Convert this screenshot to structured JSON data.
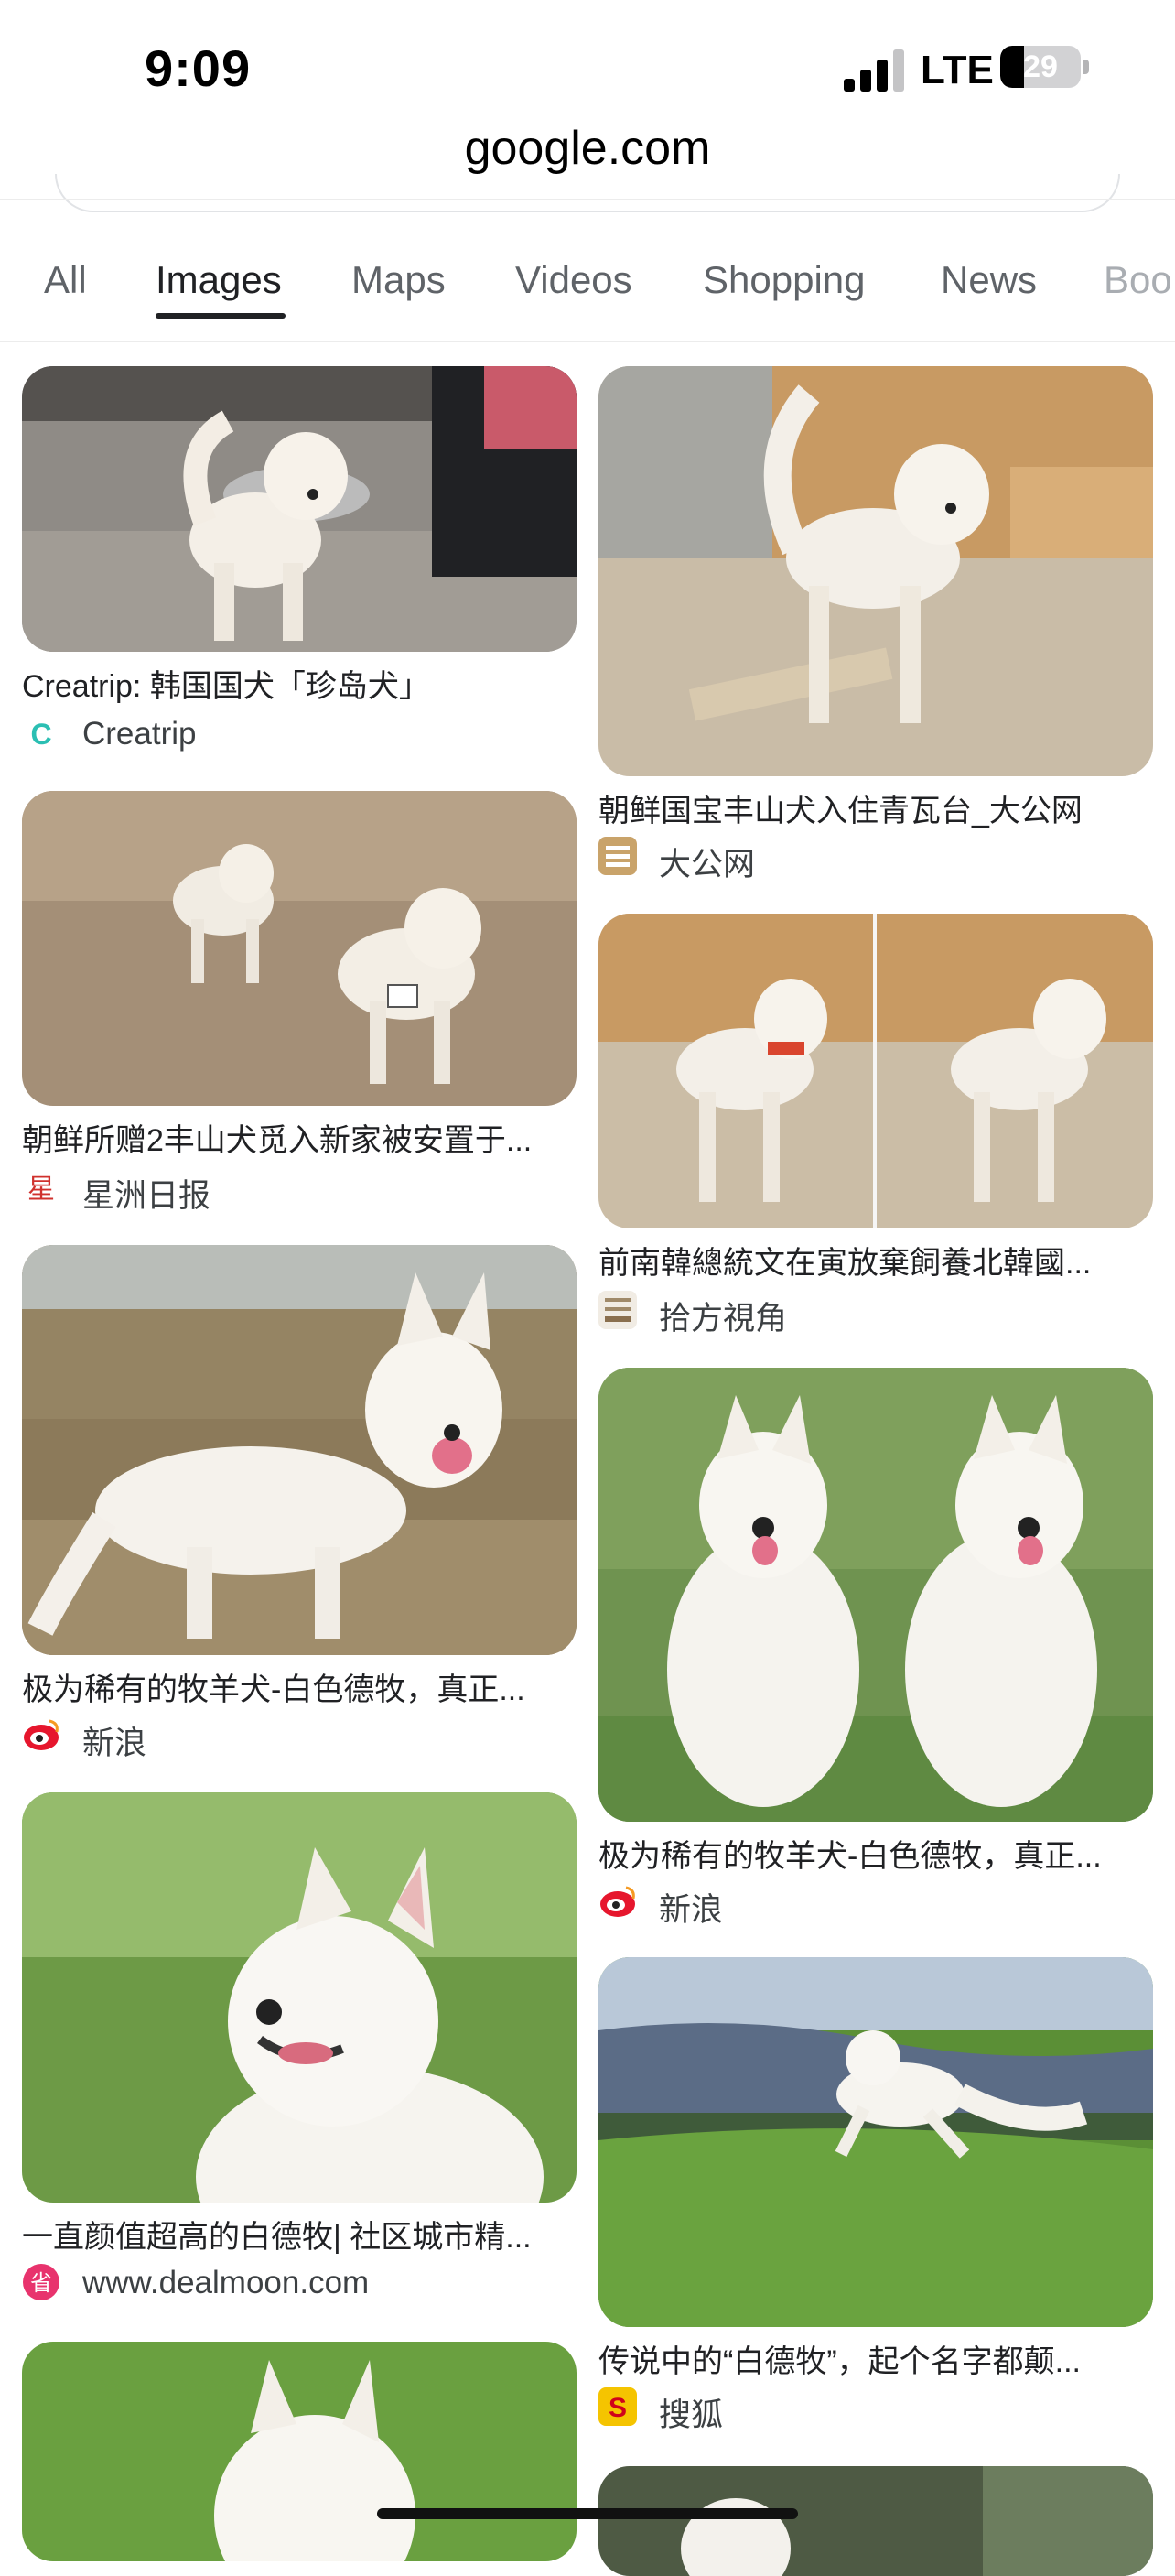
{
  "status_bar": {
    "time": "9:09",
    "network": "LTE",
    "battery_level": "29",
    "battery_fraction": 0.29
  },
  "browser": {
    "url": "google.com"
  },
  "tabs": [
    {
      "label": "All",
      "active": false
    },
    {
      "label": "Images",
      "active": true
    },
    {
      "label": "Maps",
      "active": false
    },
    {
      "label": "Videos",
      "active": false
    },
    {
      "label": "Shopping",
      "active": false
    },
    {
      "label": "News",
      "active": false
    },
    {
      "label": "Boo",
      "active": false
    }
  ],
  "results": [
    {
      "title": "Creatrip: 韩国国犬「珍岛犬」",
      "source": "Creatrip",
      "favicon": "creatrip-icon",
      "favicon_color": "#2bbfb3"
    },
    {
      "title": "朝鲜国宝丰山犬入住青瓦台_大公网",
      "source": "大公网",
      "favicon": "takungpao-icon",
      "favicon_color": "#c9a36a"
    },
    {
      "title": "朝鲜所赠2丰山犬觅入新家被安置于...",
      "source": "星洲日报",
      "favicon": "sinchew-icon",
      "favicon_color": "#d0312d"
    },
    {
      "title": "前南韓總統文在寅放棄飼養北韓國...",
      "source": "拾方視角",
      "favicon": "shifang-icon",
      "favicon_color": "#a08a6a"
    },
    {
      "title": "极为稀有的牧羊犬-白色德牧，真正...",
      "source": "新浪",
      "favicon": "sina-icon",
      "favicon_color": "#e6162d"
    },
    {
      "title": "极为稀有的牧羊犬-白色德牧，真正...",
      "source": "新浪",
      "favicon": "sina-icon",
      "favicon_color": "#e6162d"
    },
    {
      "title": "一直颜值超高的白德牧| 社区城市精...",
      "source": "www.dealmoon.com",
      "favicon": "dealmoon-icon",
      "favicon_color": "#e8336d"
    },
    {
      "title": "传说中的“白德牧”，起个名字都颠...",
      "source": "搜狐",
      "favicon": "sohu-icon",
      "favicon_color": "#f5c400"
    }
  ]
}
